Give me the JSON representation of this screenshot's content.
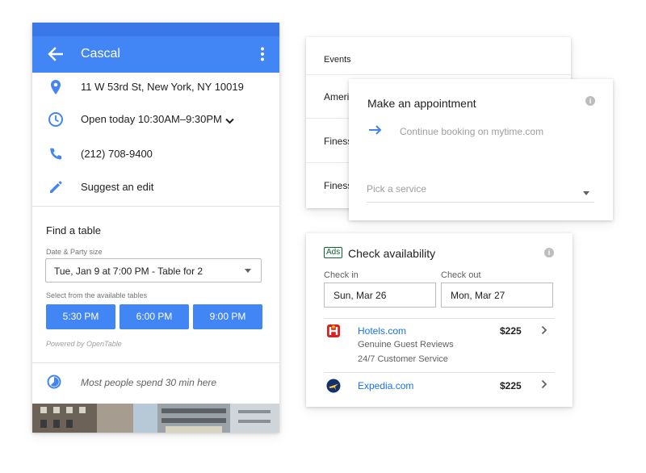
{
  "place": {
    "name": "Cascal",
    "address": "11 W 53rd St, New York, NY 10019",
    "hours": "Open today  10:30AM–9:30PM",
    "phone": "(212) 708-9400",
    "suggest_edit": "Suggest an edit"
  },
  "find_table": {
    "title": "Find a table",
    "party_label": "Date & Party size",
    "party_value": "Tue, Jan 9 at 7:00 PM - Table for 2",
    "tables_label": "Select from the available tables",
    "times": [
      "5:30 PM",
      "6:00 PM",
      "9:00 PM"
    ],
    "powered_by": "Powered by OpenTable"
  },
  "time_spent": "Most people spend 30 min here",
  "events": {
    "header": "Events",
    "rows": [
      "Ameri",
      "Finess",
      "Finess"
    ]
  },
  "appointment": {
    "title": "Make an appointment",
    "continue": "Continue booking on mytime.com",
    "pick_placeholder": "Pick a service"
  },
  "availability": {
    "ads_badge": "Ads",
    "title": "Check availability",
    "check_in_label": "Check in",
    "check_in_value": "Sun, Mar 26",
    "check_out_label": "Check out",
    "check_out_value": "Mon, Mar 27",
    "offers": [
      {
        "name": "Hotels.com",
        "lines": [
          "Genuine Guest Reviews",
          "24/7 Customer Service"
        ],
        "price": "$225",
        "icon": "hotels-logo-icon"
      },
      {
        "name": "Expedia.com",
        "lines": [],
        "price": "$225",
        "icon": "expedia-logo-icon"
      }
    ]
  },
  "colors": {
    "primary_blue": "#4285f4",
    "link_blue": "#1a73e8",
    "ads_green": "#0d652d"
  }
}
